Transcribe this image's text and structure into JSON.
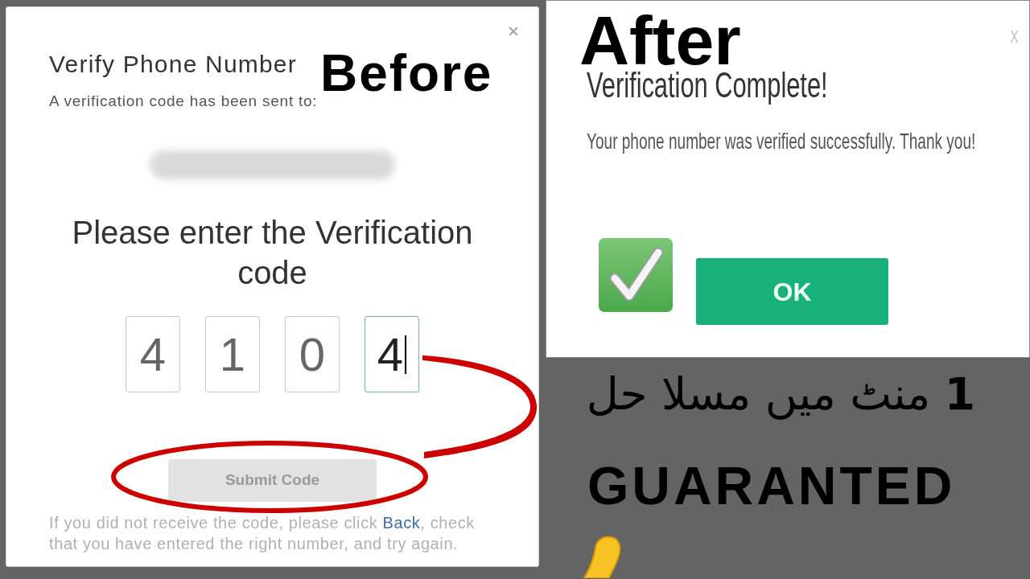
{
  "before_dialog": {
    "overlay_label": "Before",
    "close": "×",
    "title": "Verify Phone Number",
    "subtitle": "A verification code has been sent to:",
    "prompt": "Please enter the Verification code",
    "code_boxes": [
      {
        "digit": "4",
        "focused": false
      },
      {
        "digit": "1",
        "focused": false
      },
      {
        "digit": "0",
        "focused": false
      },
      {
        "digit": "4",
        "focused": true
      }
    ],
    "submit_button": {
      "label": "Submit Code",
      "disabled": true
    },
    "help_text": {
      "before": "If you did not receive the code, please click ",
      "link": "Back",
      "after": ", check that you have entered the right number, and try again."
    }
  },
  "after_dialog": {
    "overlay_label": "After",
    "close": "X",
    "title": "Verification Complete!",
    "message": "Your phone number was verified successfully. Thank you!",
    "ok_button": {
      "label": "OK"
    }
  },
  "caption": {
    "urdu_line": "**1** منٹ میں مسلا حل",
    "tagline": "GUARANTED"
  }
}
